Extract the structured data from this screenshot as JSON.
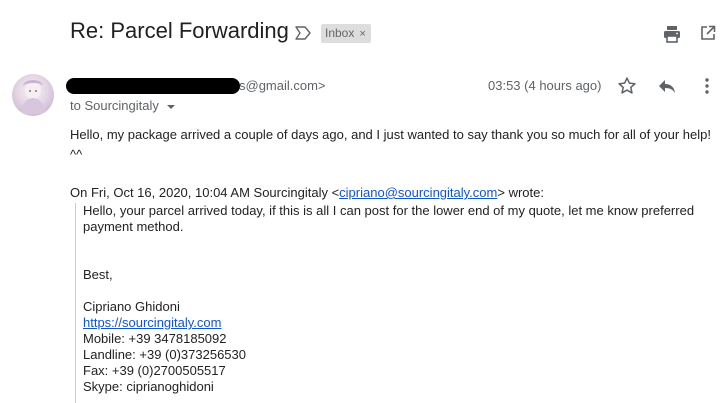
{
  "header": {
    "subject": "Re: Parcel Forwarding",
    "label_chip": "Inbox",
    "label_chip_close": "×"
  },
  "message": {
    "sender_email_suffix": "s@gmail.com>",
    "recipient_line": "to Sourcingitaly",
    "timestamp": "03:53 (4 hours ago)",
    "body_line": "Hello, my package arrived a couple of days ago, and I just wanted to say thank you so much for all of your help! ^^"
  },
  "quote": {
    "header_prefix": "On Fri, Oct 16, 2020, 10:04 AM Sourcingitaly <",
    "header_email": "cipriano@sourcingitaly.com",
    "header_suffix": "> wrote:",
    "line1": "Hello, your parcel arrived today, if this is all I can post for the lower end of my quote, let me know preferred payment method.",
    "closing": "Best,",
    "signature_name": "Cipriano Ghidoni",
    "signature_link": "https://sourcingitaly.com",
    "mobile": "Mobile: +39 3478185092",
    "landline": "Landline: +39 (0)373256530",
    "fax": "Fax: +39 (0)2700505517",
    "skype": "Skype: ciprianoghidoni"
  },
  "icons": [
    "important-marker-icon",
    "print-icon",
    "open-in-new-window-icon",
    "star-icon",
    "reply-icon",
    "more-vert-icon",
    "chevron-down-icon"
  ],
  "colors": {
    "link": "#1155cc",
    "chip_bg": "#dddddd",
    "meta_text": "#5f6368"
  }
}
